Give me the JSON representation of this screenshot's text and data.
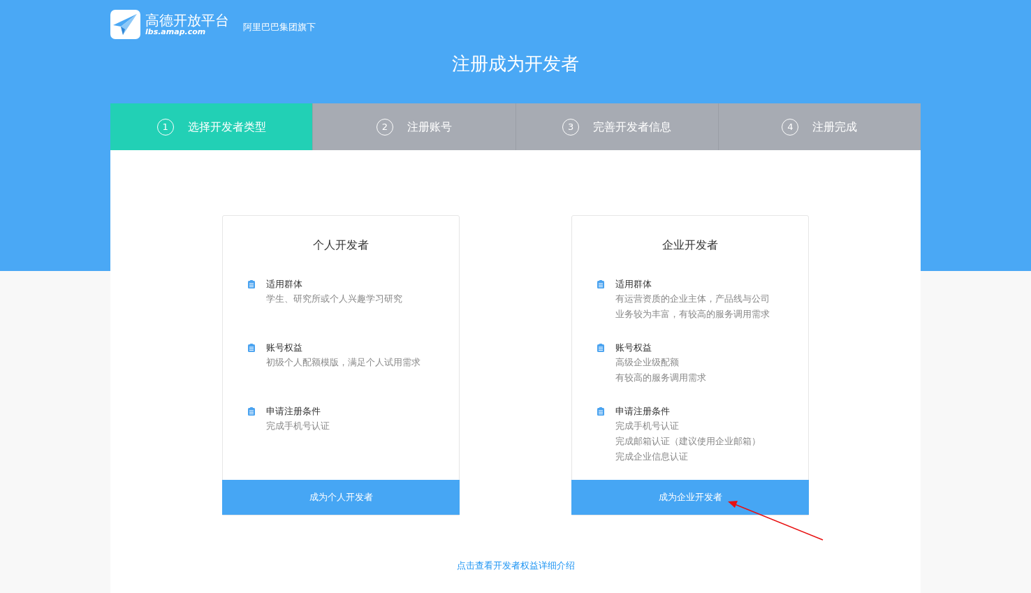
{
  "header": {
    "logo_title": "高德开放平台",
    "logo_domain": "lbs.amap.com",
    "tagline": "阿里巴巴集团旗下"
  },
  "page_title": "注册成为开发者",
  "steps": [
    {
      "number": "1",
      "label": "选择开发者类型",
      "selected": true
    },
    {
      "number": "2",
      "label": "注册账号",
      "selected": false
    },
    {
      "number": "3",
      "label": "完善开发者信息",
      "selected": false
    },
    {
      "number": "4",
      "label": "注册完成",
      "selected": false
    }
  ],
  "cards": [
    {
      "title": "个人开发者",
      "sections": [
        {
          "heading": "适用群体",
          "lines": [
            "学生、研究所或个人兴趣学习研究"
          ]
        },
        {
          "heading": "账号权益",
          "lines": [
            "初级个人配额模版，满足个人试用需求"
          ]
        },
        {
          "heading": "申请注册条件",
          "lines": [
            "完成手机号认证"
          ]
        }
      ],
      "button": "成为个人开发者"
    },
    {
      "title": "企业开发者",
      "sections": [
        {
          "heading": "适用群体",
          "lines": [
            "有运营资质的企业主体，产品线与公司",
            "业务较为丰富，有较高的服务调用需求"
          ]
        },
        {
          "heading": "账号权益",
          "lines": [
            "高级企业级配额",
            "有较高的服务调用需求"
          ]
        },
        {
          "heading": "申请注册条件",
          "lines": [
            "完成手机号认证",
            "完成邮箱认证（建议使用企业邮箱）",
            "完成企业信息认证"
          ]
        }
      ],
      "button": "成为企业开发者"
    }
  ],
  "details_link": "点击查看开发者权益详细介绍"
}
